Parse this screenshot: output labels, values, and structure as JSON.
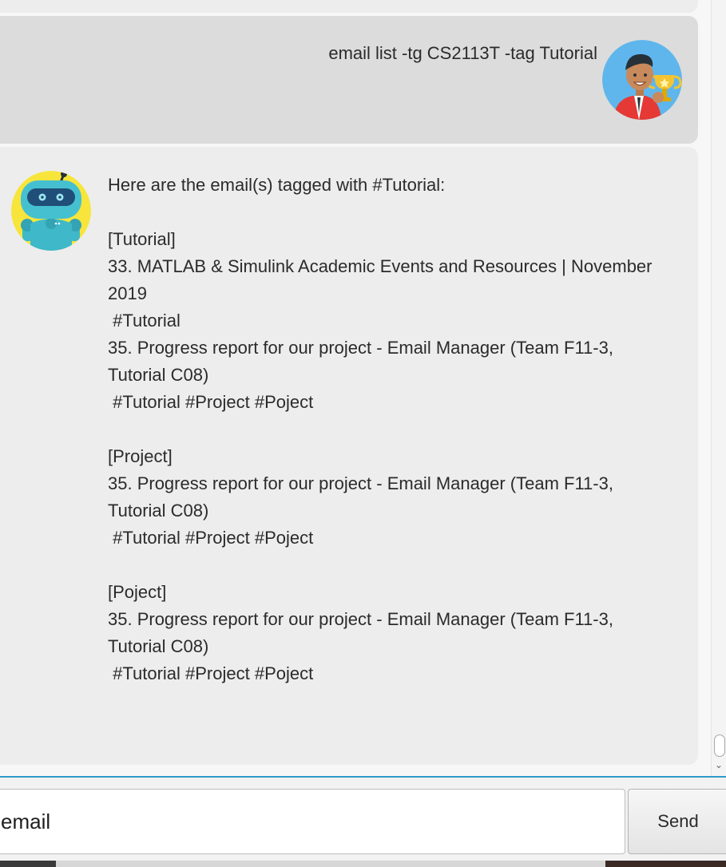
{
  "chat": {
    "user_message": "email list -tg CS2113T -tag Tutorial",
    "bot_message": "Here are the email(s) tagged with #Tutorial:\n\n[Tutorial]\n33. MATLAB & Simulink Academic Events and Resources | November 2019\n #Tutorial\n35. Progress report for our project - Email Manager (Team F11-3, Tutorial C08)\n #Tutorial #Project #Poject\n\n[Project]\n35. Progress report for our project - Email Manager (Team F11-3, Tutorial C08)\n #Tutorial #Project #Poject\n\n[Poject]\n35. Progress report for our project - Email Manager (Team F11-3, Tutorial C08)\n #Tutorial #Project #Poject"
  },
  "input": {
    "value": "email"
  },
  "send_label": "Send",
  "colors": {
    "accent": "#2d99c9",
    "user_bubble": "#dcdcdc",
    "bot_bubble": "#ededed"
  },
  "icons": {
    "user_avatar": "user-avatar-icon",
    "bot_avatar": "robot-avatar-icon",
    "scroll_down": "chevron-down-icon"
  }
}
